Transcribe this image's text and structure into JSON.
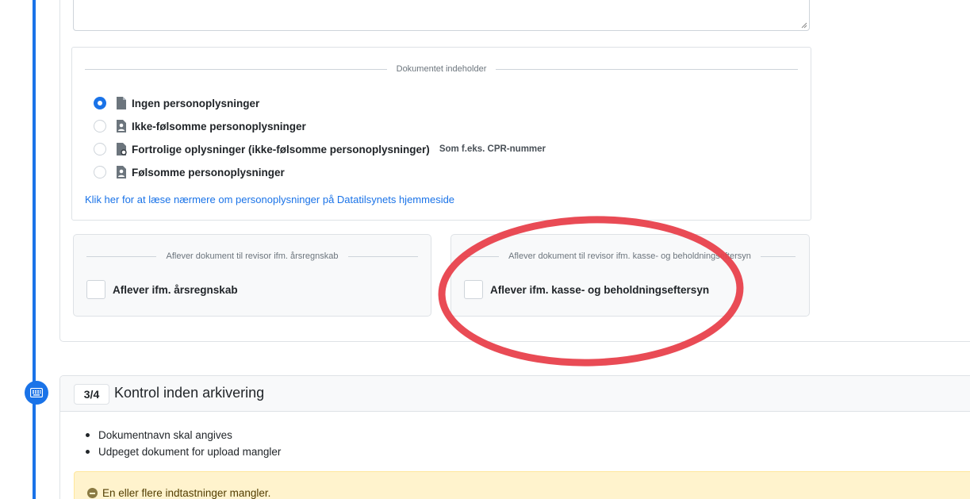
{
  "content_section": {
    "legend": "Dokumentet indeholder",
    "options": [
      {
        "label": "Ingen personoplysninger",
        "hint": "",
        "checked": true,
        "icon": "document-icon"
      },
      {
        "label": "Ikke-følsomme personoplysninger",
        "hint": "",
        "checked": false,
        "icon": "person-document-icon"
      },
      {
        "label": "Fortrolige oplysninger (ikke-følsomme personoplysninger)",
        "hint": "Som f.eks. CPR-nummer",
        "checked": false,
        "icon": "confidential-document-icon"
      },
      {
        "label": "Følsomme personoplysninger",
        "hint": "",
        "checked": false,
        "icon": "person-document-icon"
      }
    ],
    "info_link": "Klik her for at læse nærmere om personoplysninger på Datatilsynets hjemmeside"
  },
  "yearly_report": {
    "legend": "Aflever dokument til revisor ifm. årsregnskab",
    "checkbox_label": "Aflever ifm. årsregnskab",
    "checked": false
  },
  "cash_inspection": {
    "legend": "Aflever dokument til revisor ifm. kasse- og beholdningseftersyn",
    "checkbox_label": "Aflever ifm. kasse- og beholdningseftersyn",
    "checked": false
  },
  "step3": {
    "badge": "3/4",
    "title": "Kontrol inden arkivering",
    "issues": [
      "Dokumentnavn skal angives",
      "Udpeget dokument for upload mangler"
    ],
    "warning": "En eller flere indtastninger mangler."
  },
  "colors": {
    "accent": "#1a73e8",
    "annotation": "#e8414c",
    "warning_bg": "#fff3cd"
  }
}
